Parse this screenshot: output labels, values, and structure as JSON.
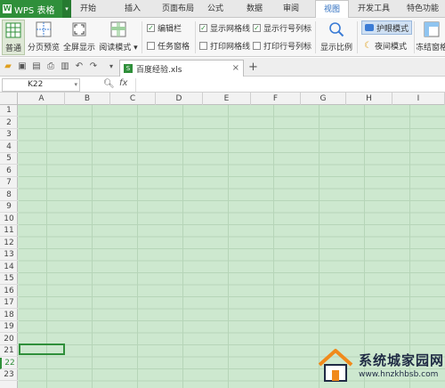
{
  "app": {
    "logo_text": "WPS 表格"
  },
  "tabs": [
    "开始",
    "插入",
    "页面布局",
    "公式",
    "数据",
    "审阅",
    "视图",
    "开发工具",
    "特色功能"
  ],
  "active_tab": "视图",
  "ribbon": {
    "buttons": {
      "normal": "普通",
      "page_break": "分页预览",
      "full_screen": "全屏显示",
      "reading_mode": "阅读模式 ▾",
      "zoom": "显示比例",
      "freeze": "冻结窗格"
    },
    "checks": {
      "edit_bar": {
        "label": "编辑栏",
        "checked": true
      },
      "task_pane": {
        "label": "任务窗格",
        "checked": false
      },
      "show_gridlines": {
        "label": "显示网格线",
        "checked": true
      },
      "print_gridlines": {
        "label": "打印网格线",
        "checked": false
      },
      "show_headings": {
        "label": "显示行号列标",
        "checked": true
      },
      "print_headings": {
        "label": "打印行号列标",
        "checked": false
      }
    },
    "eye_mode": "护眼模式",
    "night_mode": "夜间模式"
  },
  "document": {
    "filename": "百度经验.xls"
  },
  "formula_bar": {
    "name_box": "K22",
    "fx": "fx",
    "value": ""
  },
  "columns": [
    "A",
    "B",
    "C",
    "D",
    "E",
    "F",
    "G",
    "H",
    "I"
  ],
  "rows": [
    "1",
    "2",
    "3",
    "4",
    "5",
    "6",
    "7",
    "8",
    "9",
    "10",
    "11",
    "12",
    "13",
    "14",
    "15",
    "16",
    "17",
    "18",
    "19",
    "20",
    "21",
    "22",
    "23"
  ],
  "selected_row": "22",
  "watermark": {
    "title": "系统城家园网",
    "url": "www.hnzkhbsb.com"
  },
  "colors": {
    "brand": "#2f8f3a",
    "grid_bg": "#cde8cf",
    "active_tab_text": "#2b6cbf"
  }
}
